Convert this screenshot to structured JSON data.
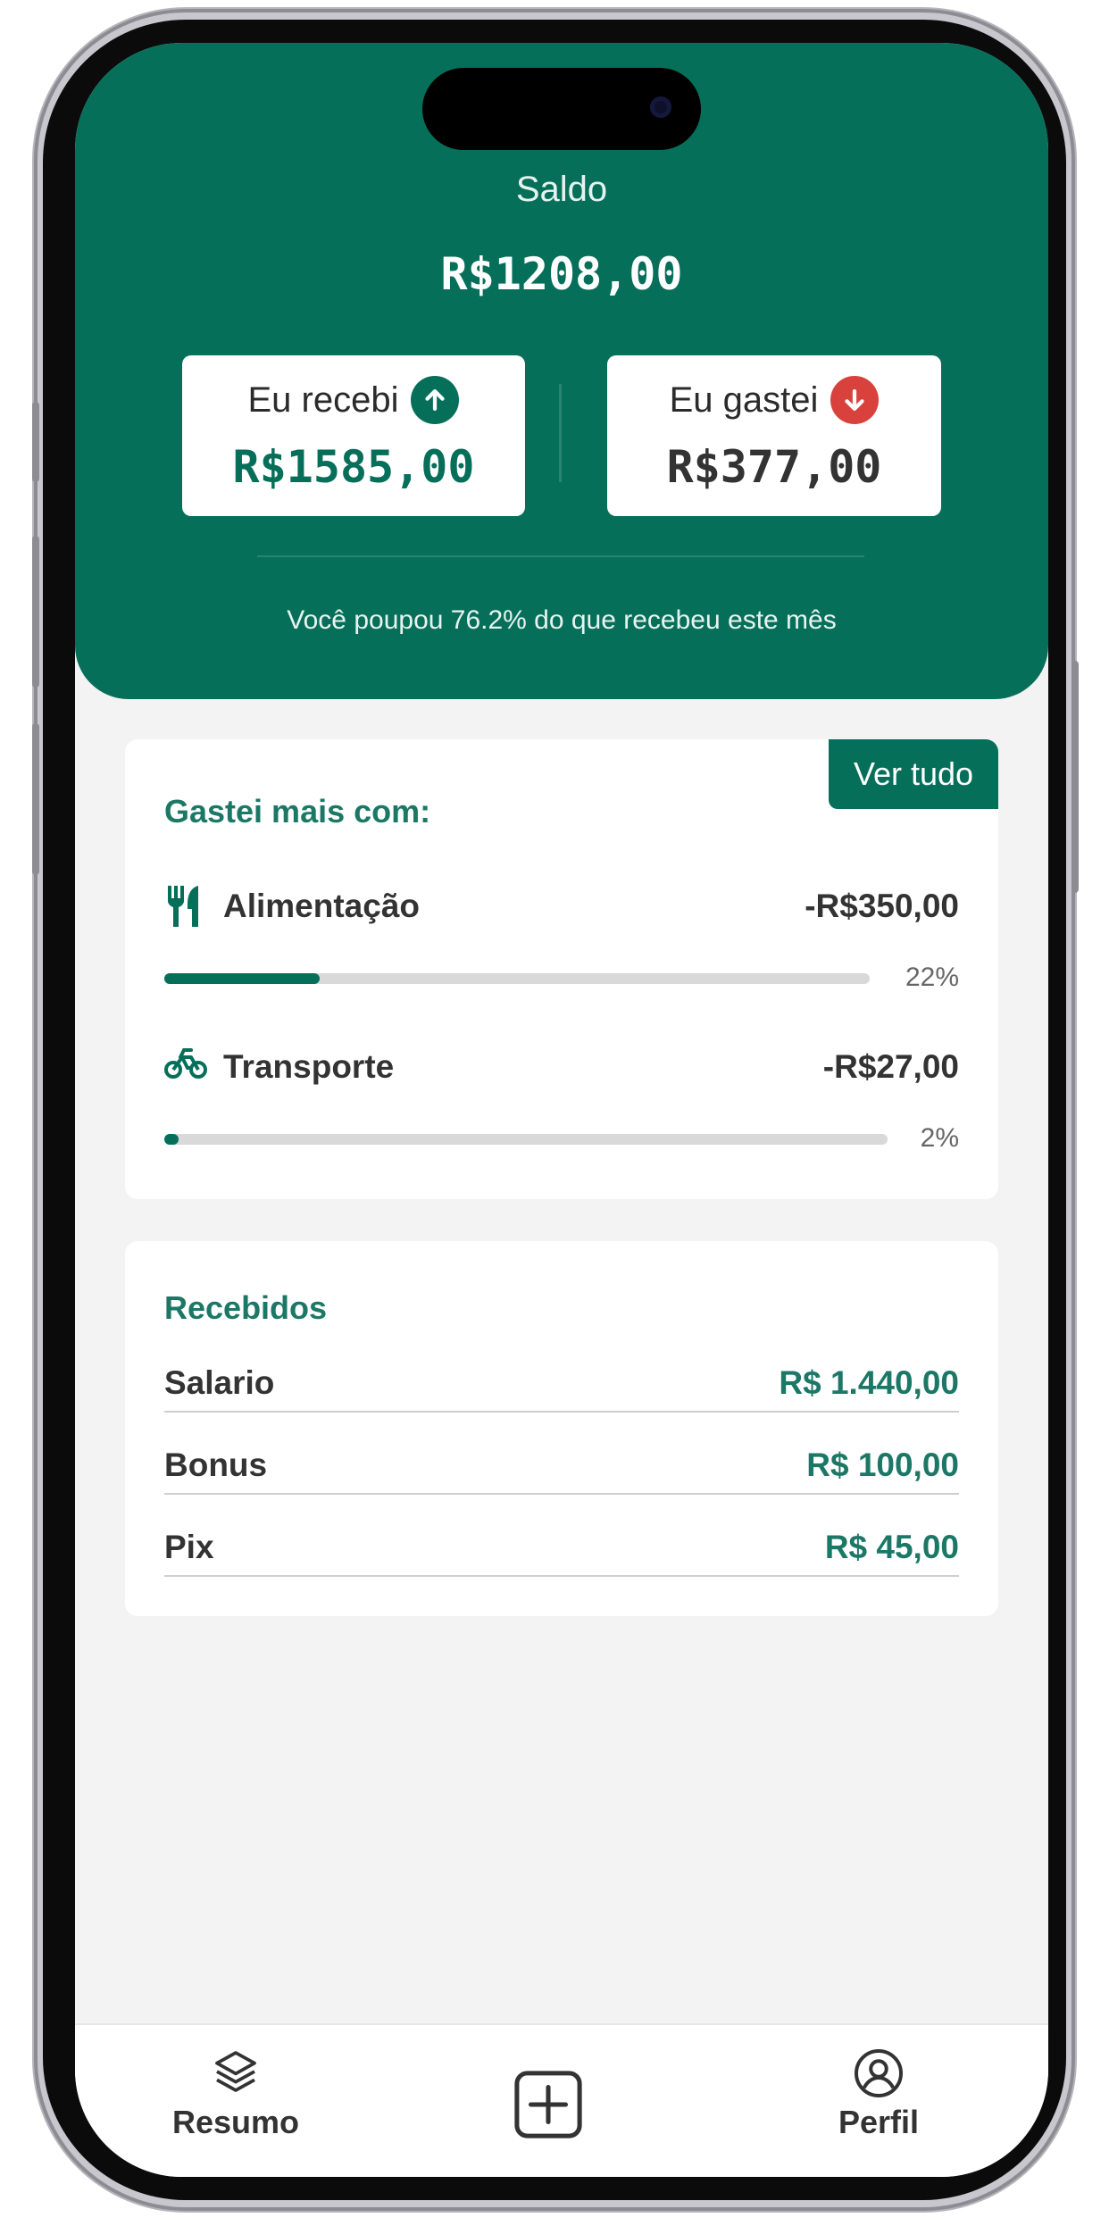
{
  "header": {
    "balance_label": "Saldo",
    "balance_value": "R$1208,00",
    "received": {
      "label": "Eu recebi",
      "value": "R$1585,00",
      "icon": "arrow-up-icon",
      "icon_color": "#066f5a",
      "value_color": "#066f5a"
    },
    "spent": {
      "label": "Eu gastei",
      "value": "R$377,00",
      "icon": "arrow-down-icon",
      "icon_color": "#d9423c",
      "value_color": "#333333"
    },
    "savings_message": "Você poupou 76.2% do que recebeu este mês"
  },
  "spending": {
    "title": "Gastei mais com:",
    "see_all_label": "Ver tudo",
    "categories": [
      {
        "name": "Alimentação",
        "amount": "-R$350,00",
        "percent_label": "22%",
        "percent": 22,
        "icon": "utensils-icon"
      },
      {
        "name": "Transporte",
        "amount": "-R$27,00",
        "percent_label": "2%",
        "percent": 2,
        "icon": "motorcycle-icon"
      }
    ]
  },
  "received": {
    "title": "Recebidos",
    "items": [
      {
        "name": "Salario",
        "value": "R$ 1.440,00"
      },
      {
        "name": "Bonus",
        "value": "R$ 100,00"
      },
      {
        "name": "Pix",
        "value": "R$ 45,00"
      }
    ]
  },
  "tabbar": {
    "items": [
      {
        "label": "Resumo",
        "icon": "layers-icon"
      },
      {
        "label": "",
        "icon": "plus-square-icon"
      },
      {
        "label": "Perfil",
        "icon": "user-circle-icon"
      }
    ]
  },
  "colors": {
    "brand": "#066f5a",
    "danger": "#d9423c",
    "background": "#f3f3f3"
  }
}
